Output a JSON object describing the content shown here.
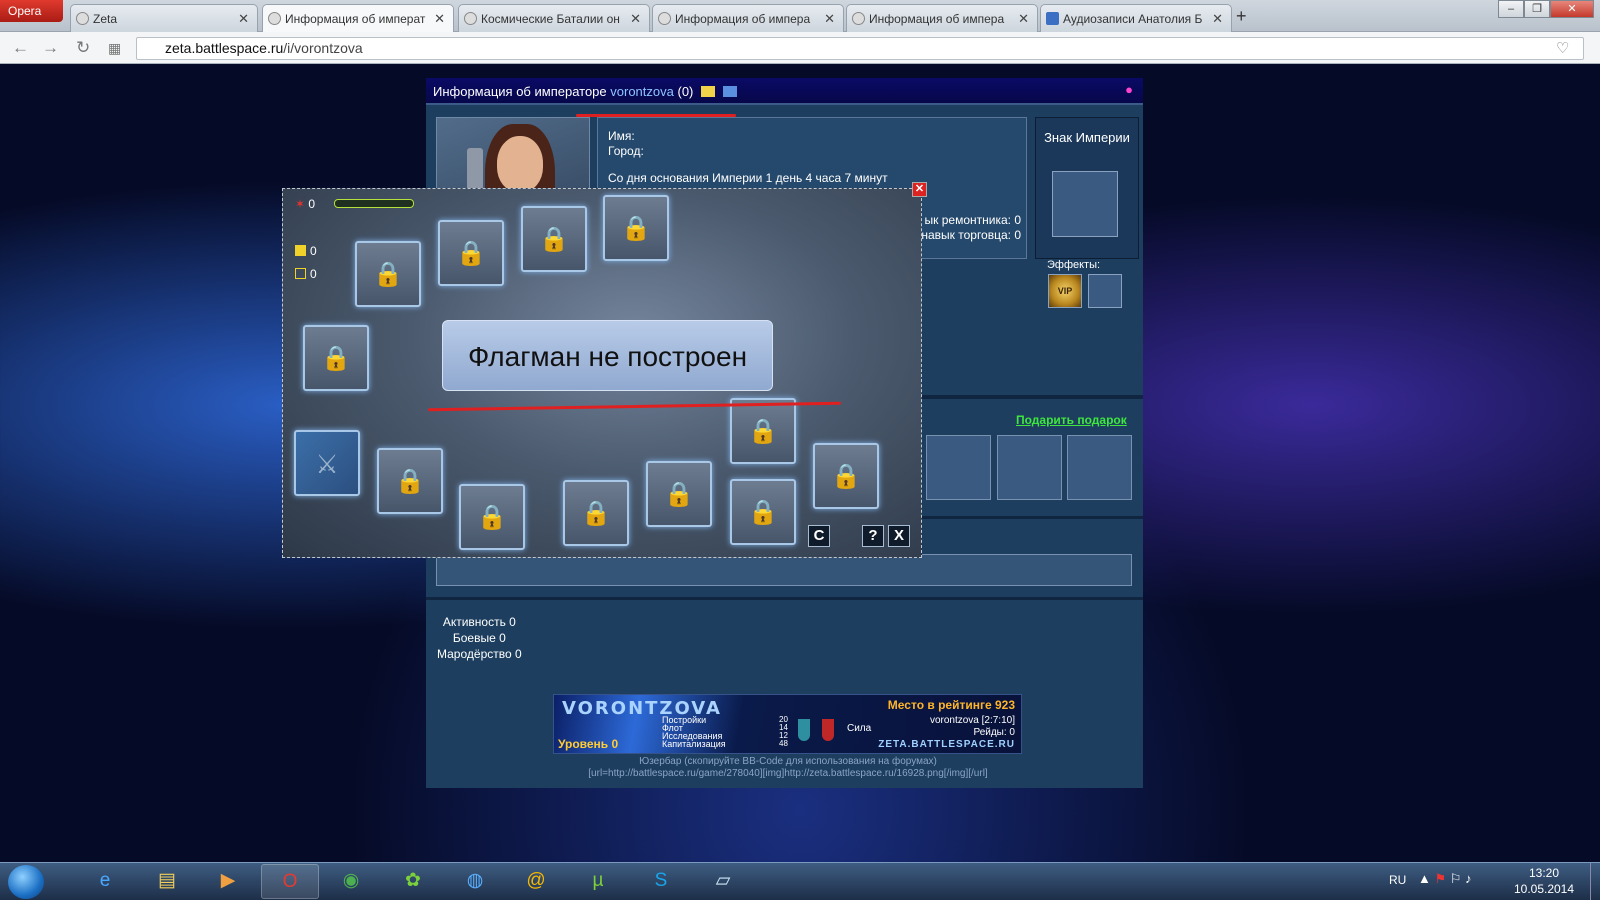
{
  "browser": {
    "menu_label": "Opera",
    "tabs": [
      {
        "label": "Zeta"
      },
      {
        "label": "Информация об императ"
      },
      {
        "label": "Космические Баталии он"
      },
      {
        "label": "Информация об импера"
      },
      {
        "label": "Информация об импера"
      },
      {
        "label": "Аудиозаписи Анатолия Б"
      }
    ],
    "new_tab": "+",
    "url_domain": "zeta.battlespace.ru",
    "url_path": "/i/vorontzova",
    "window_buttons": [
      "–",
      "❐",
      "✕"
    ]
  },
  "header": {
    "title": "Информация об императоре",
    "name": "vorontzova",
    "count": "(0)"
  },
  "profile": {
    "name_label": "Имя:",
    "city_label": "Город:",
    "founded": "Со дня основания Империи 1 день 4 часа 7 минут",
    "repair_skill": "ык ремонтника: 0",
    "trade_skill": "навык торговца: 0"
  },
  "emblem": {
    "title": "Знак Империи",
    "effects_label": "Эффекты:",
    "vip": "VIP"
  },
  "gift_link": "Подарить подарок",
  "stats": {
    "activity": "Активность 0",
    "combat": "Боевые 0",
    "looting": "Мародёрство 0"
  },
  "userbar": {
    "name": "VORONTZOVA",
    "level": "Уровень 0",
    "rank": "Место в рейтинге 923",
    "rows": [
      "Постройки",
      "Флот",
      "Исследования",
      "Капитализация"
    ],
    "row_values": [
      "20",
      "14",
      "12",
      "48"
    ],
    "power_label": "Сила",
    "coords": "vorontzova [2:7:10]",
    "raids": "Рейды: 0",
    "site": "ZETA.BATTLESPACE.RU",
    "caption": "Юзербар (скопируйте BB-Code для использования на форумах)",
    "bbcode": "[url=http://battlespace.ru/game/278040][img]http://zeta.battlespace.ru/16928.png[/img][/url]"
  },
  "popup": {
    "stars_value": "0",
    "cube_value": "0",
    "cube2_value": "0",
    "message": "Флагман не построен",
    "btn_refresh": "C",
    "btn_help": "?",
    "btn_close": "X"
  },
  "taskbar": {
    "lang": "RU",
    "time": "13:20",
    "date": "10.05.2014"
  },
  "colors": {
    "gift_link": "#3ee63e",
    "rank_text": "#ffb52a",
    "redline": "#e02020"
  }
}
